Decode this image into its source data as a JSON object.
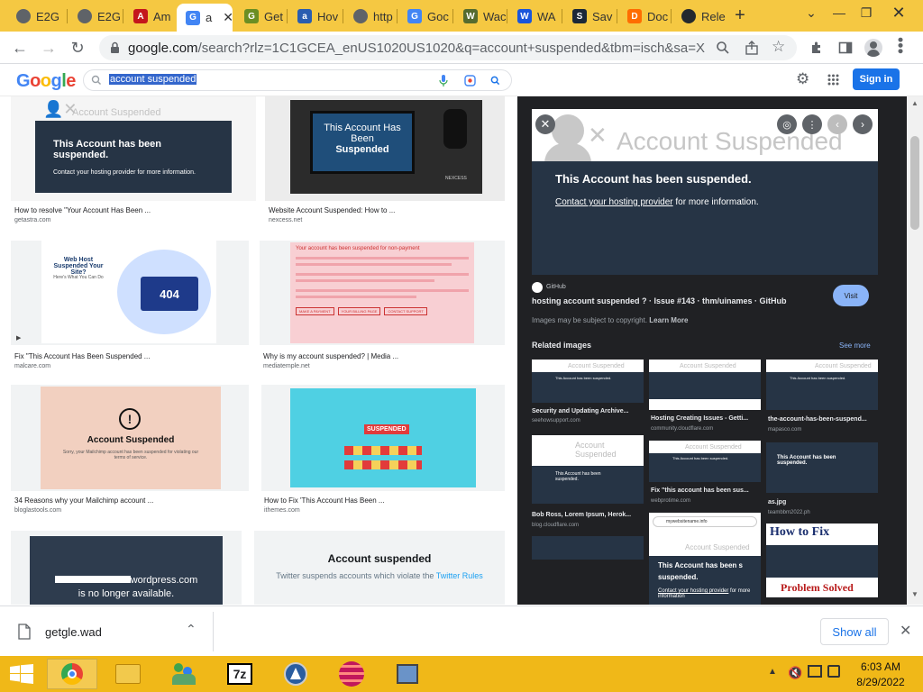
{
  "tabs": [
    {
      "label": "E2G",
      "fav": "globe",
      "color": "#5f6368"
    },
    {
      "label": "E2G",
      "fav": "globe",
      "color": "#5f6368"
    },
    {
      "label": "Am",
      "fav": "A",
      "color": "#c4161c"
    },
    {
      "label": "a",
      "fav": "G",
      "color": "#4285f4",
      "active": true
    },
    {
      "label": "Get",
      "fav": "G",
      "color": "#6b8e23"
    },
    {
      "label": "Hov",
      "fav": "a",
      "color": "#2a5db0"
    },
    {
      "label": "http",
      "fav": "globe",
      "color": "#5f6368"
    },
    {
      "label": "Goc",
      "fav": "G",
      "color": "#4285f4"
    },
    {
      "label": "Wac",
      "fav": "W",
      "color": "#556b2f"
    },
    {
      "label": "WA",
      "fav": "W",
      "color": "#1a56db"
    },
    {
      "label": "Sav",
      "fav": "S",
      "color": "#1b2838"
    },
    {
      "label": "Doc",
      "fav": "D",
      "color": "#ff6d00"
    },
    {
      "label": "Rele",
      "fav": "gh",
      "color": "#24292e"
    }
  ],
  "address": {
    "host": "google.com",
    "path": "/search?rlz=1C1GCEA_enUS1020US1020&q=account+suspended&tbm=isch&sa=X&ved..."
  },
  "google": {
    "logo": "Google",
    "query": "account suspended",
    "signin": "Sign in"
  },
  "results": [
    {
      "caption": "How to resolve \"Your Account Has Been ...",
      "source": "getastra.com",
      "title": "This Account has been suspended.",
      "sub": "Contact your hosting provider for more information.",
      "header": "Account Suspended"
    },
    {
      "caption": "Website Account Suspended: How to ...",
      "source": "nexcess.net",
      "title": "This Account Has Been",
      "title2": "Suspended",
      "brand": "NEXCESS"
    },
    {
      "caption": "Fix \"This Account Has Been Suspended ...",
      "source": "malcare.com",
      "title": "Web Host Suspended Your Site?",
      "sub": "Here's What You Can Do",
      "code": "404"
    },
    {
      "caption": "Why is my account suspended? | Media ...",
      "source": "mediatemple.net",
      "title": "Your account has been suspended for non-payment",
      "btn1": "MAKE A PAYMENT",
      "btn2": "YOUR BILLING PAGE",
      "btn3": "CONTACT SUPPORT"
    },
    {
      "caption": "34 Reasons why your Mailchimp account ...",
      "source": "bloglastools.com",
      "title": "Account Suspended",
      "sub": "Sorry, your Mailchimp account has been suspended for violating our terms of service."
    },
    {
      "caption": "How to Fix 'This Account Has Been ...",
      "source": "ithemes.com",
      "title": "SUSPENDED"
    },
    {
      "title": "wordpress.com",
      "sub": "is no longer available."
    },
    {
      "title": "Account suspended",
      "sub": "Twitter suspends accounts which violate the",
      "link": "Twitter Rules"
    }
  ],
  "panel": {
    "preview_header": "Account Suspended",
    "preview_title": "This Account has been suspended.",
    "preview_link": "Contact your hosting provider",
    "preview_rest": "for more information.",
    "source": "GitHub",
    "title": "hosting account suspended ? · Issue #143 · thm/uinames · GitHub",
    "visit": "Visit",
    "copyright": "Images may be subject to copyright.",
    "learn_more": "Learn More",
    "related": "Related images",
    "see_more": "See more",
    "related_items": [
      {
        "caption": "Security and Updating Archive...",
        "source": "seehowsupport.com"
      },
      {
        "caption": "Hosting Creating Issues - Getti...",
        "source": "community.cloudflare.com"
      },
      {
        "caption": "the-account-has-been-suspend...",
        "source": "mapasco.com"
      },
      {
        "caption": "Bob Ross, Lorem Ipsum, Herok...",
        "source": "blog.cloudflare.com"
      },
      {
        "caption": "Fix \"this account has been sus...",
        "source": "webprotime.com"
      },
      {
        "caption": "as.jpg",
        "source": "teambbm2022.ph"
      }
    ],
    "r_thumb_title": "This Account has been suspended.",
    "r_thumb_header": "Account Suspended",
    "r_big_title": "This Account has been s",
    "r_big_title2": "suspended.",
    "r_big_link": "Contact your hosting provider",
    "r_big_rest": "for more information",
    "r_url": "mywebsitename.info",
    "howto": "How to Fix",
    "solved": "Problem Solved"
  },
  "download": {
    "file": "getgle.wad",
    "show_all": "Show all"
  },
  "clock": {
    "time": "6:03 AM",
    "date": "8/29/2022"
  },
  "taskbar_labels": {
    "sevenzip": "7z"
  }
}
